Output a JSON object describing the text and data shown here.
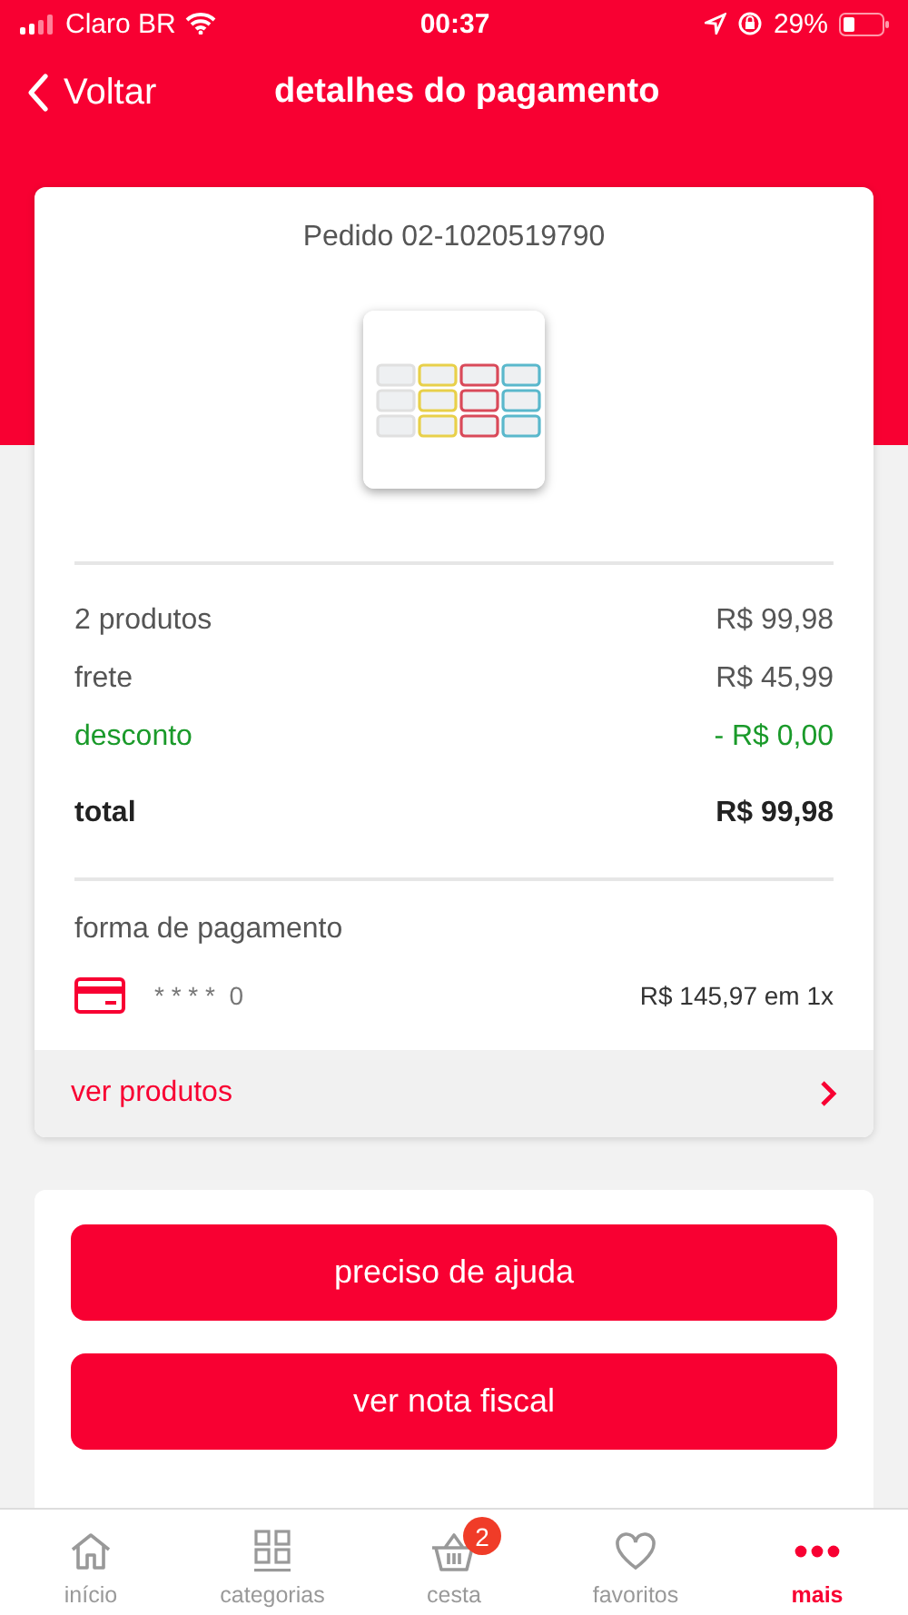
{
  "status_bar": {
    "carrier": "Claro BR",
    "time": "00:37",
    "battery": "29%"
  },
  "nav": {
    "back": "Voltar",
    "title": "detalhes do pagamento"
  },
  "order": {
    "title": "Pedido 02-1020519790",
    "summary": [
      {
        "kind": "normal",
        "label": "2 produtos",
        "value": "R$ 99,98"
      },
      {
        "kind": "normal",
        "label": "frete",
        "value": "R$ 45,99"
      },
      {
        "kind": "discount",
        "label": "desconto",
        "value": "- R$ 0,00"
      },
      {
        "kind": "total",
        "label": "total",
        "value": "R$ 99,98"
      }
    ],
    "payment": {
      "heading": "forma de pagamento",
      "card": "* * * *  0",
      "amount": "R$ 145,97 em 1x"
    },
    "link": "ver produtos"
  },
  "actions": [
    "preciso de ajuda",
    "ver nota fiscal"
  ],
  "tabs": [
    {
      "kind": "home",
      "label": "início",
      "selected": false
    },
    {
      "kind": "grid",
      "label": "categorias",
      "selected": false
    },
    {
      "kind": "basket",
      "label": "cesta",
      "selected": false,
      "badge": "2"
    },
    {
      "kind": "heart",
      "label": "favoritos",
      "selected": false
    },
    {
      "kind": "more",
      "label": "mais",
      "selected": true
    }
  ]
}
